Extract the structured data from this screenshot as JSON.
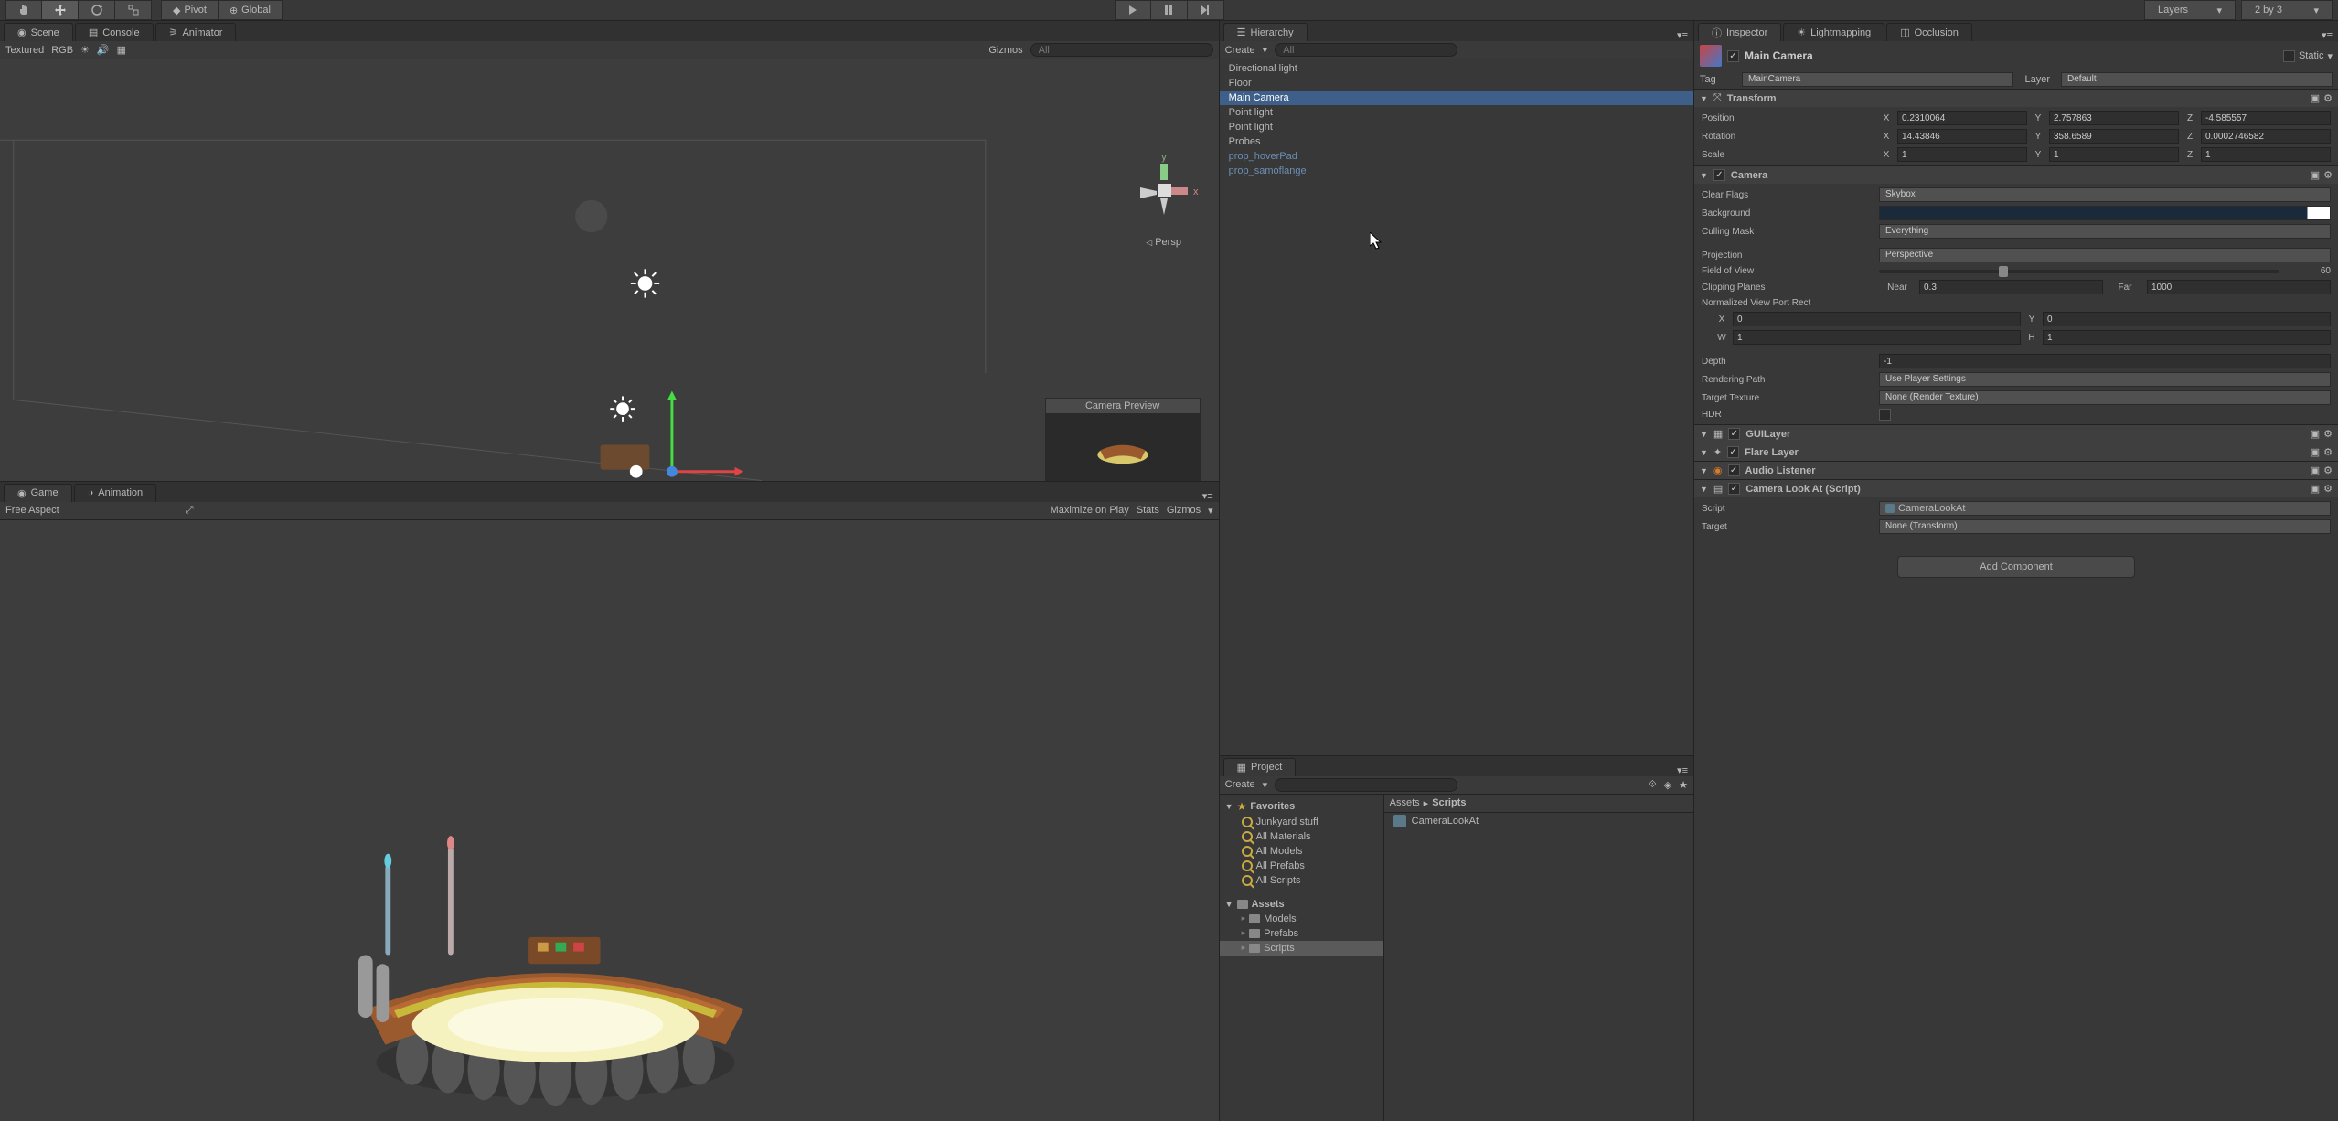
{
  "toolbar": {
    "pivot": "Pivot",
    "global": "Global",
    "layers": "Layers",
    "layout": "2 by 3"
  },
  "tabs": {
    "scene": "Scene",
    "console": "Console",
    "animator": "Animator",
    "game": "Game",
    "animation": "Animation",
    "hierarchy": "Hierarchy",
    "project": "Project",
    "inspector": "Inspector",
    "lightmapping": "Lightmapping",
    "occlusion": "Occlusion"
  },
  "scene_toolbar": {
    "shading": "Textured",
    "render": "RGB",
    "gizmos": "Gizmos",
    "search_placeholder": "All"
  },
  "game_toolbar": {
    "aspect": "Free Aspect",
    "maximize": "Maximize on Play",
    "stats": "Stats",
    "gizmos": "Gizmos"
  },
  "camera_preview": "Camera Preview",
  "persp": "Persp",
  "hierarchy": {
    "create": "Create",
    "items": [
      {
        "label": "Directional light",
        "selected": false,
        "prefab": false
      },
      {
        "label": "Floor",
        "selected": false,
        "prefab": false
      },
      {
        "label": "Main Camera",
        "selected": true,
        "prefab": false
      },
      {
        "label": "Point light",
        "selected": false,
        "prefab": false
      },
      {
        "label": "Point light",
        "selected": false,
        "prefab": false
      },
      {
        "label": "Probes",
        "selected": false,
        "prefab": false
      },
      {
        "label": "prop_hoverPad",
        "selected": false,
        "prefab": true
      },
      {
        "label": "prop_samoflange",
        "selected": false,
        "prefab": true
      }
    ]
  },
  "project": {
    "create": "Create",
    "breadcrumb": [
      "Assets",
      "Scripts"
    ],
    "favorites_label": "Favorites",
    "favorites": [
      "Junkyard stuff",
      "All Materials",
      "All Models",
      "All Prefabs",
      "All Scripts"
    ],
    "assets_label": "Assets",
    "folders": [
      "Models",
      "Prefabs",
      "Scripts"
    ],
    "selected_folder": "Scripts",
    "content": [
      "CameraLookAt"
    ]
  },
  "inspector": {
    "object_name": "Main Camera",
    "static": "Static",
    "tag_label": "Tag",
    "tag_value": "MainCamera",
    "layer_label": "Layer",
    "layer_value": "Default",
    "transform": {
      "title": "Transform",
      "position_label": "Position",
      "rotation_label": "Rotation",
      "scale_label": "Scale",
      "position": {
        "x": "0.2310064",
        "y": "2.757863",
        "z": "-4.585557"
      },
      "rotation": {
        "x": "14.43846",
        "y": "358.6589",
        "z": "0.0002746582"
      },
      "scale": {
        "x": "1",
        "y": "1",
        "z": "1"
      }
    },
    "camera": {
      "title": "Camera",
      "clear_flags_label": "Clear Flags",
      "clear_flags": "Skybox",
      "background_label": "Background",
      "culling_mask_label": "Culling Mask",
      "culling_mask": "Everything",
      "projection_label": "Projection",
      "projection": "Perspective",
      "fov_label": "Field of View",
      "fov": "60",
      "clipping_label": "Clipping Planes",
      "near_label": "Near",
      "near": "0.3",
      "far_label": "Far",
      "far": "1000",
      "viewport_label": "Normalized View Port Rect",
      "viewport": {
        "x": "0",
        "y": "0",
        "w": "1",
        "h": "1"
      },
      "depth_label": "Depth",
      "depth": "-1",
      "rendering_path_label": "Rendering Path",
      "rendering_path": "Use Player Settings",
      "target_texture_label": "Target Texture",
      "target_texture": "None (Render Texture)",
      "hdr_label": "HDR"
    },
    "guilayer": "GUILayer",
    "flare_layer": "Flare Layer",
    "audio_listener": "Audio Listener",
    "camera_lookat": {
      "title": "Camera Look At (Script)",
      "script_label": "Script",
      "script_value": "CameraLookAt",
      "target_label": "Target",
      "target_value": "None (Transform)"
    },
    "add_component": "Add Component"
  }
}
